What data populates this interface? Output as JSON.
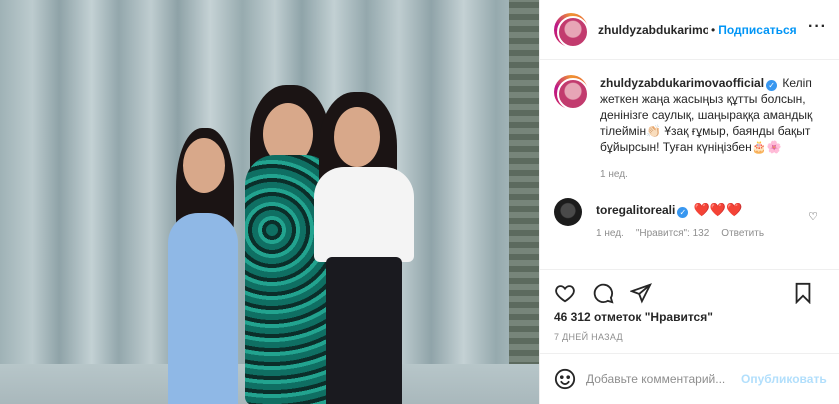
{
  "post": {
    "image_alt": "",
    "author": {
      "username_header": "zhuldyzabdukarimova",
      "username": "zhuldyzabdukarimovaofficial",
      "follow_label": "Подписаться",
      "dot": "•"
    },
    "caption": {
      "text": "Келіп жеткен жаңа жасыңыз құтты болсын, денінізге саулық, шаңыраққа амандық тілеймін👏🏻 Ұзақ ғұмыр, баянды бақыт бұйырсын! Туған күніңізбен🎂🌸",
      "time": "1 нед."
    },
    "comments": [
      {
        "username": "toregalitoreali",
        "text": "❤️❤️❤️",
        "time": "1 нед.",
        "likes_label": "\"Нравится\": 132",
        "reply_label": "Ответить"
      }
    ],
    "likes_text": "46 312 отметок \"Нравится\"",
    "date": "7 ДНЕЙ НАЗАД",
    "add_comment": {
      "placeholder": "Добавьте комментарий...",
      "publish_label": "Опубликовать"
    }
  },
  "icons": {
    "more": "more-horizontal-icon",
    "like": "heart-icon",
    "comment": "comment-icon",
    "share": "share-icon",
    "save": "bookmark-icon",
    "emoji": "emoji-icon"
  },
  "colors": {
    "accent": "#0095f6",
    "text": "#262626",
    "muted": "#8e8e8e",
    "heart": "#e0245e"
  }
}
